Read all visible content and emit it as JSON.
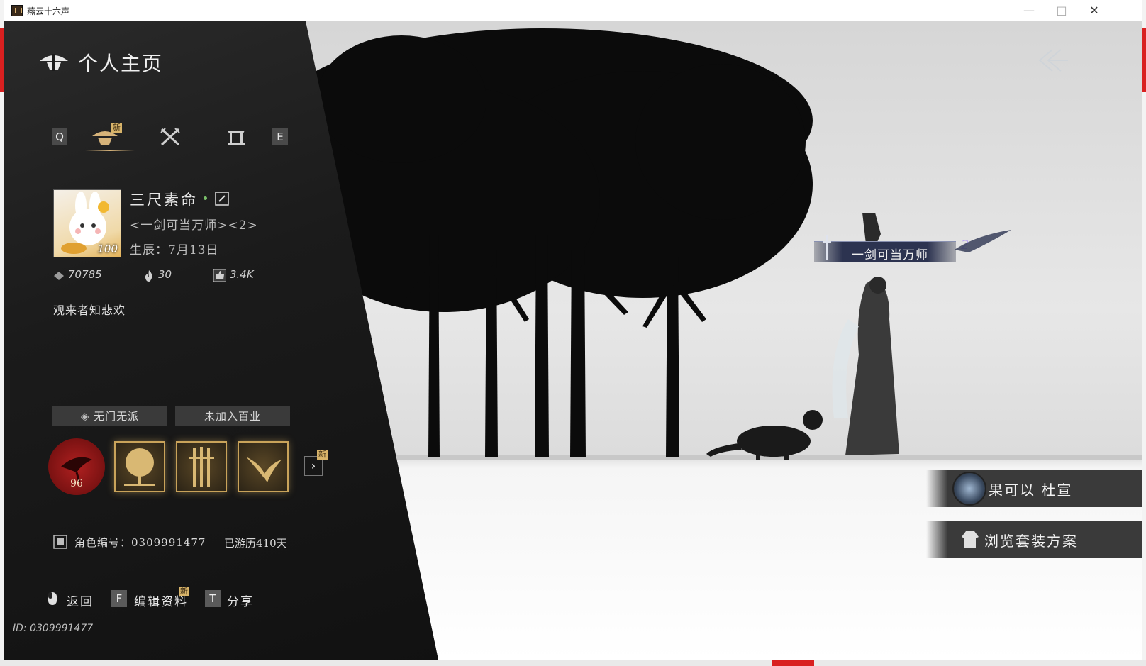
{
  "window": {
    "title": "燕云十六声",
    "minimize": "—",
    "maximize": "□",
    "close": "✕"
  },
  "header": {
    "title": "个人主页"
  },
  "tabs": {
    "prev_key": "Q",
    "next_key": "E",
    "new_badge": "新",
    "items": [
      {
        "icon": "lantern-icon",
        "active": true
      },
      {
        "icon": "crossed-swords-icon",
        "active": false
      },
      {
        "icon": "gate-icon",
        "active": false
      }
    ]
  },
  "profile": {
    "name": "三尺素命",
    "title": "<一剑可当万师><2>",
    "birthday": "生辰：7月13日",
    "level": "100",
    "stats": {
      "score": "70785",
      "fire": "30",
      "likes": "3.4K"
    },
    "motto": "观来者知悲欢"
  },
  "affiliation": {
    "sect": "无门无派",
    "profession": "未加入百业"
  },
  "badges": {
    "seal_value": "96",
    "new_badge": "新",
    "more": "›"
  },
  "info": {
    "role_id": "角色编号：0309991477",
    "days": "已游历410天"
  },
  "footer": {
    "back_label": "返回",
    "edit_key": "F",
    "edit_label": "编辑资料",
    "edit_new": "新",
    "share_key": "T",
    "share_label": "分享",
    "id_label": "ID: 0309991477"
  },
  "scene": {
    "title_banner": "一剑可当万师",
    "title_rank": "2"
  },
  "side_buttons": {
    "outfit_label": "果可以 杜宣",
    "browse_label": "浏览套装方案"
  },
  "colors": {
    "panel": "#1b1b1b",
    "gold": "#d6b37a",
    "accent_red": "#d92020"
  }
}
